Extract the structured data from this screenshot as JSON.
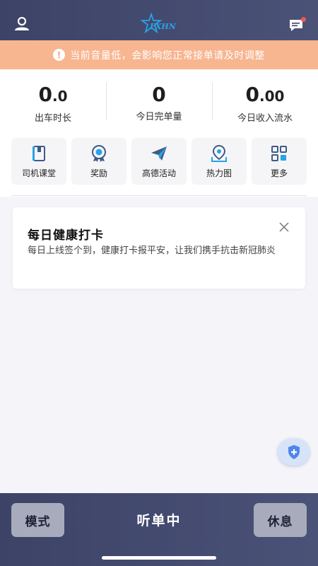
{
  "header": {
    "user_icon": "user-icon",
    "logo_text": "FXHN",
    "message_icon": "message-icon",
    "has_unread": true,
    "bg_color": "#3c4367"
  },
  "notice": {
    "icon": "warning-icon",
    "text": "当前音量低，会影响您正常接单请及时调整",
    "bg_color": "#f7b590"
  },
  "stats": {
    "duration": {
      "int": "0",
      "dec": ".0",
      "label": "出车时长"
    },
    "orders": {
      "value": "0",
      "label": "今日完单量"
    },
    "income": {
      "int": "0",
      "dec": ".00",
      "label": "今日收入流水"
    }
  },
  "shortcuts": [
    {
      "label": "司机课堂",
      "icon": "book-icon"
    },
    {
      "label": "奖励",
      "icon": "medal-icon"
    },
    {
      "label": "高德活动",
      "icon": "paper-plane-icon"
    },
    {
      "label": "热力图",
      "icon": "location-pin-icon"
    },
    {
      "label": "更多",
      "icon": "grid-icon"
    }
  ],
  "health_card": {
    "title": "每日健康打卡",
    "description": "每日上线签个到，健康打卡报平安，让我们携手抗击新冠肺炎",
    "close_icon": "close-icon"
  },
  "fab": {
    "icon": "shield-plus-icon"
  },
  "bottom_bar": {
    "mode_label": "模式",
    "status": "听单中",
    "rest_label": "休息"
  }
}
